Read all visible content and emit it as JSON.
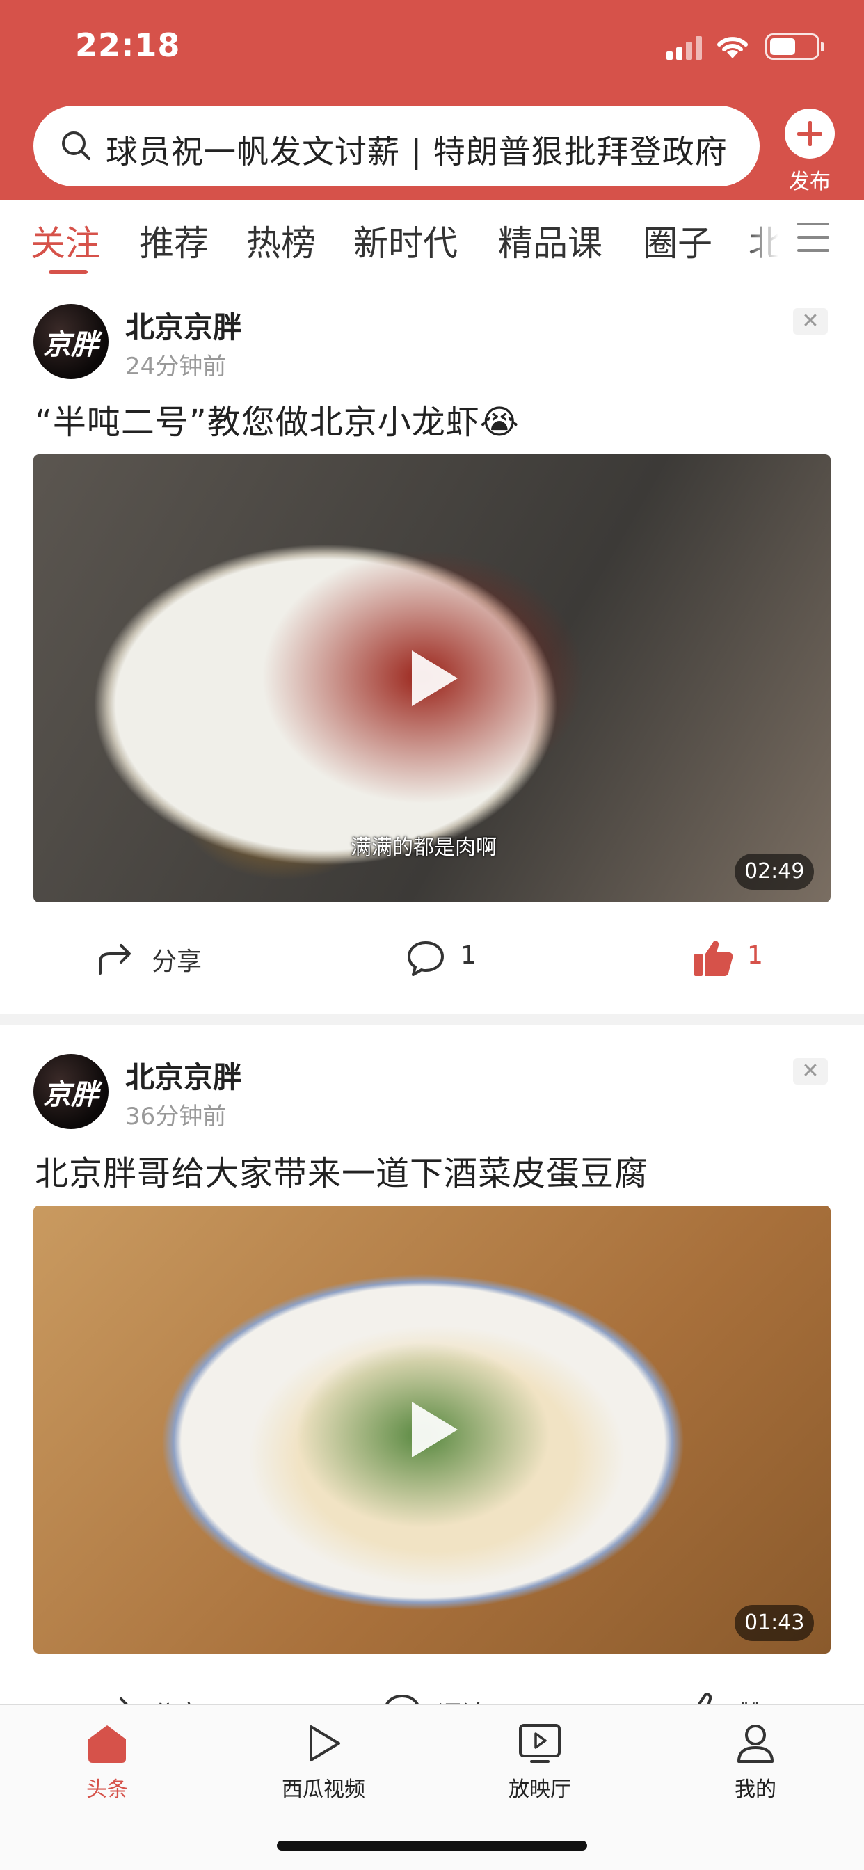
{
  "status_bar": {
    "time": "22:18"
  },
  "search": {
    "placeholder": "球员祝一帆发文讨薪 | 特朗普狠批拜登政府"
  },
  "publish": {
    "label": "发布"
  },
  "tabs": [
    {
      "label": "关注",
      "active": true
    },
    {
      "label": "推荐"
    },
    {
      "label": "热榜"
    },
    {
      "label": "新时代"
    },
    {
      "label": "精品课"
    },
    {
      "label": "圈子"
    },
    {
      "label": "北"
    }
  ],
  "feed": [
    {
      "author": "北京京胖",
      "avatar_text": "京胖",
      "time": "24分钟前",
      "title": "“半吨二号”教您做北京小龙虾😭",
      "video_subtitle": "满满的都是肉啊",
      "duration": "02:49",
      "share_label": "分享",
      "comment_count": "1",
      "like_count": "1",
      "liked": true
    },
    {
      "author": "北京京胖",
      "avatar_text": "京胖",
      "time": "36分钟前",
      "title": "北京胖哥给大家带来一道下酒菜皮蛋豆腐",
      "duration": "01:43",
      "share_label": "分享",
      "comment_label": "评论",
      "like_label": "赞"
    }
  ],
  "bottom_nav": [
    {
      "label": "头条",
      "icon": "home-icon",
      "active": true
    },
    {
      "label": "西瓜视频",
      "icon": "play-icon"
    },
    {
      "label": "放映厅",
      "icon": "tv-icon"
    },
    {
      "label": "我的",
      "icon": "person-icon"
    }
  ],
  "colors": {
    "brand": "#d6524a"
  }
}
